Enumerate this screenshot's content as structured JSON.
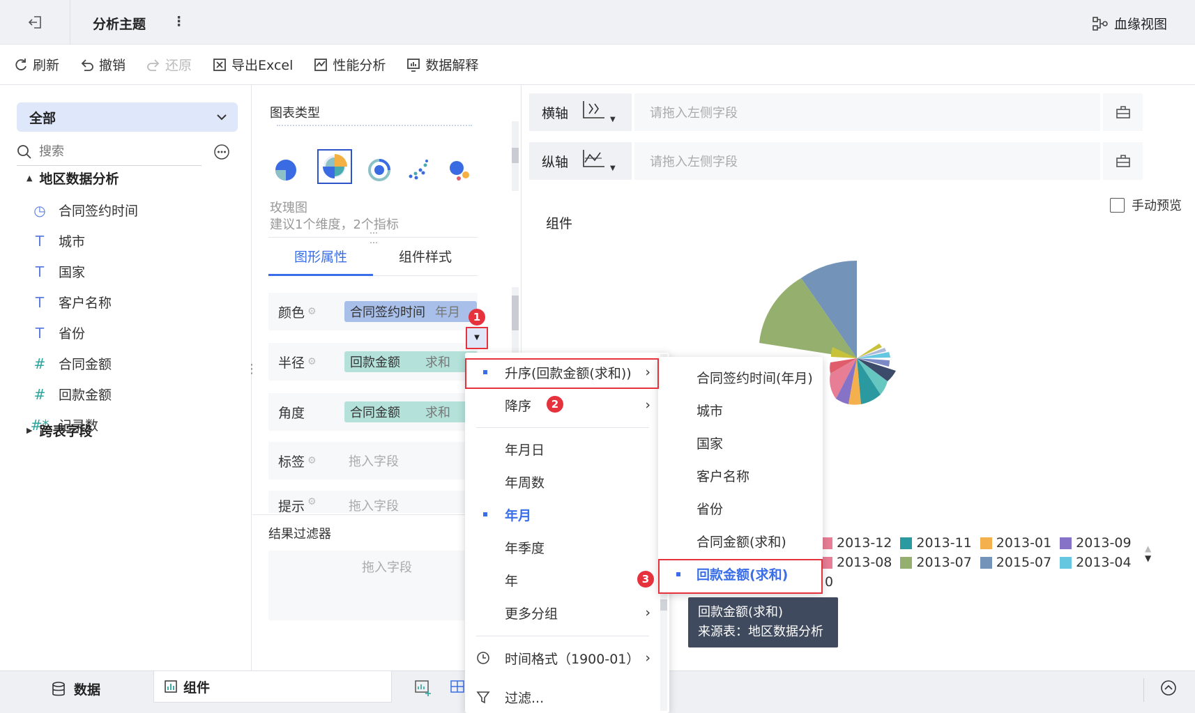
{
  "topbar": {
    "title": "分析主题",
    "more": "⋮",
    "lineage": "血缘视图"
  },
  "toolbar": {
    "refresh": "刷新",
    "undo": "撤销",
    "redo": "还原",
    "export": "导出Excel",
    "perf": "性能分析",
    "explain": "数据解释"
  },
  "left": {
    "dropdown": "全部",
    "search_placeholder": "搜索",
    "group1": "地区数据分析",
    "fields": [
      {
        "icon": "◷",
        "label": "合同签约时间",
        "color": "#5b7be0"
      },
      {
        "icon": "T",
        "label": "城市",
        "color": "#5b7be0"
      },
      {
        "icon": "T",
        "label": "国家",
        "color": "#5b7be0"
      },
      {
        "icon": "T",
        "label": "客户名称",
        "color": "#5b7be0"
      },
      {
        "icon": "T",
        "label": "省份",
        "color": "#5b7be0"
      },
      {
        "icon": "#",
        "label": "合同金额",
        "color": "#2aa59b"
      },
      {
        "icon": "#",
        "label": "回款金额",
        "color": "#2aa59b"
      },
      {
        "icon": "#*",
        "label": "记录数",
        "color": "#2aa59b"
      }
    ],
    "group2": "跨表字段"
  },
  "mid": {
    "chart_type_label": "图表类型",
    "chart_name": "玫瑰图",
    "chart_hint": "建议1个维度，2个指标",
    "tab_graph": "图形属性",
    "tab_style": "组件样式",
    "props": {
      "color": {
        "label": "颜色",
        "pill": "合同签约时间",
        "suffix": "年月"
      },
      "radius": {
        "label": "半径",
        "pill": "回款金额",
        "suffix": "求和"
      },
      "angle": {
        "label": "角度",
        "pill": "合同金额",
        "suffix": "求和"
      },
      "label": {
        "label": "标签",
        "placeholder": "拖入字段"
      },
      "tooltip": {
        "label": "提示",
        "placeholder": "拖入字段"
      }
    },
    "filter_title": "结果过滤器",
    "filter_placeholder": "拖入字段"
  },
  "right": {
    "x_axis": "横轴",
    "y_axis": "纵轴",
    "axis_placeholder": "请拖入左侧字段",
    "manual_preview": "手动预览",
    "component_title": "组件",
    "legend_row1": [
      {
        "label": "2013-12",
        "color": "#e87e95"
      },
      {
        "label": "2013-11",
        "color": "#2b9aa0"
      },
      {
        "label": "2013-01",
        "color": "#f5b04e"
      },
      {
        "label": "2013-09",
        "color": "#8673c7"
      }
    ],
    "legend_row2": [
      {
        "label": "2013-08",
        "color": "#e87e95"
      },
      {
        "label": "2013-07",
        "color": "#95b06e"
      },
      {
        "label": "2015-07",
        "color": "#7393b8"
      },
      {
        "label": "2013-04",
        "color": "#66c7e0"
      }
    ],
    "legend_extra": "0"
  },
  "menu": {
    "asc": "升序(回款金额(求和))",
    "desc": "降序",
    "ymd": "年月日",
    "ywk": "年周数",
    "ym": "年月",
    "yq": "年季度",
    "y": "年",
    "more_group": "更多分组",
    "time_format": "时间格式（1900-01）",
    "filter": "过滤..."
  },
  "submenu": {
    "items": [
      "合同签约时间(年月)",
      "城市",
      "国家",
      "客户名称",
      "省份",
      "合同金额(求和)",
      "回款金额(求和)"
    ]
  },
  "tooltip": {
    "line1": "回款金额(求和)",
    "line2": "来源表：地区数据分析"
  },
  "badges": {
    "b1": "1",
    "b2": "2",
    "b3": "3"
  },
  "bottom": {
    "data_tab": "数据",
    "component_tab": "组件"
  }
}
